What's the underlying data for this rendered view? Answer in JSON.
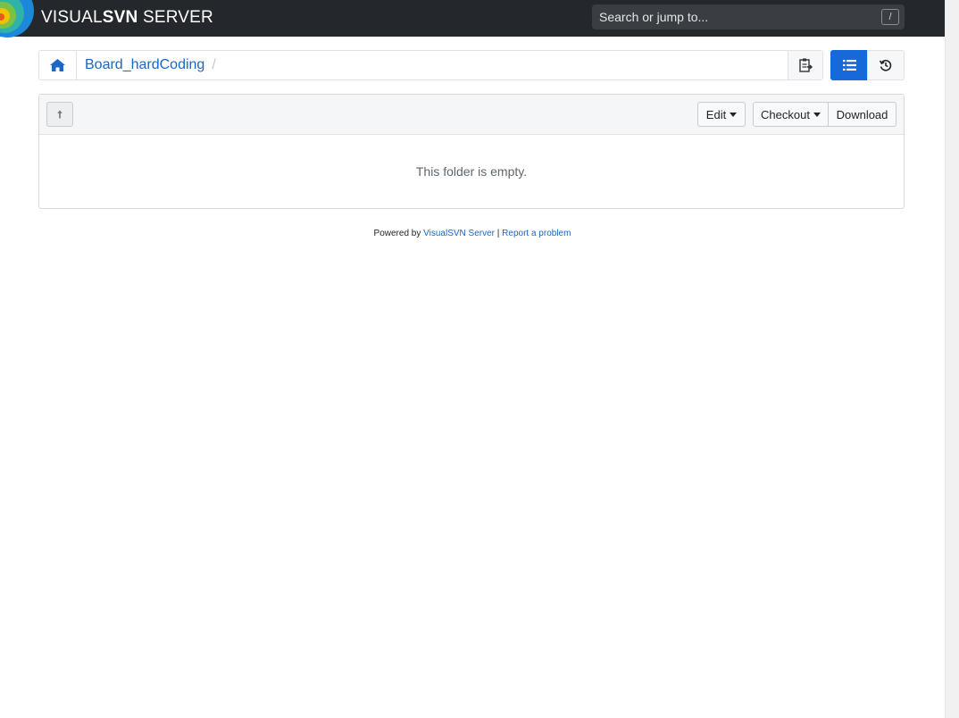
{
  "brand": {
    "prefix": "VISUAL",
    "bold": "SVN",
    "suffix": " SERVER"
  },
  "search": {
    "placeholder": "Search or jump to...",
    "shortcut": "/"
  },
  "breadcrumb": {
    "repo": "Board_hardCoding",
    "separator": "/"
  },
  "toolbar": {
    "edit_label": "Edit",
    "checkout_label": "Checkout",
    "download_label": "Download"
  },
  "content": {
    "empty_message": "This folder is empty."
  },
  "footer": {
    "powered_by": "Powered by",
    "product_link": "VisualSVN Server",
    "divider": "|",
    "report_link": "Report a problem"
  },
  "colors": {
    "navbar": "#24272b",
    "accent": "#1768d8",
    "link": "#1a66c9"
  },
  "icons": {
    "home": "home-icon",
    "copy": "clipboard-icon",
    "list_view": "list-icon",
    "history": "history-icon",
    "up": "up-arrow-icon"
  }
}
